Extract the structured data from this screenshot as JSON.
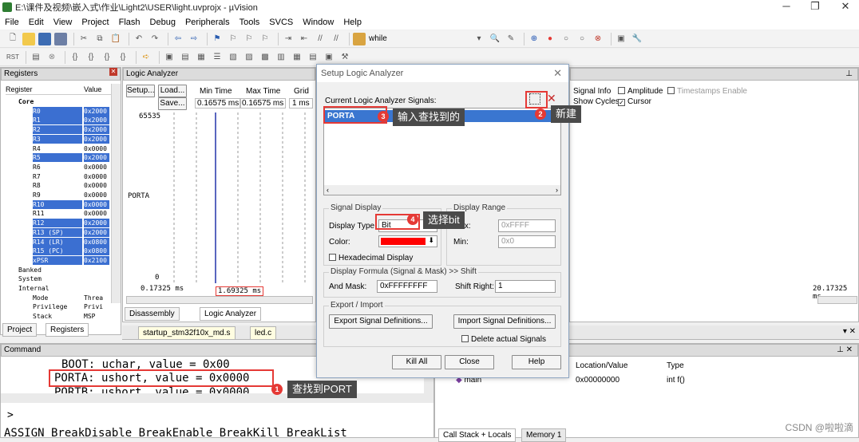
{
  "window": {
    "title": "E:\\课件及视频\\嵌入式\\作业\\Light2\\USER\\light.uvprojx - µVision",
    "minimize": "─",
    "maximize": "❐",
    "close": "✕"
  },
  "menu": [
    "File",
    "Edit",
    "View",
    "Project",
    "Flash",
    "Debug",
    "Peripherals",
    "Tools",
    "SVCS",
    "Window",
    "Help"
  ],
  "toolbar": {
    "search_text": "while"
  },
  "registers": {
    "title": "Registers",
    "col_register": "Register",
    "col_value": "Value",
    "rows": [
      {
        "name": "Core",
        "value": "",
        "sel": false
      },
      {
        "name": "R0",
        "value": "0x2000",
        "sel": true
      },
      {
        "name": "R1",
        "value": "0x2000",
        "sel": true
      },
      {
        "name": "R2",
        "value": "0x2000",
        "sel": true
      },
      {
        "name": "R3",
        "value": "0x2000",
        "sel": true
      },
      {
        "name": "R4",
        "value": "0x0000",
        "sel": false
      },
      {
        "name": "R5",
        "value": "0x2000",
        "sel": true
      },
      {
        "name": "R6",
        "value": "0x0000",
        "sel": false
      },
      {
        "name": "R7",
        "value": "0x0000",
        "sel": false
      },
      {
        "name": "R8",
        "value": "0x0000",
        "sel": false
      },
      {
        "name": "R9",
        "value": "0x0000",
        "sel": false
      },
      {
        "name": "R10",
        "value": "0x0000",
        "sel": true
      },
      {
        "name": "R11",
        "value": "0x0000",
        "sel": false
      },
      {
        "name": "R12",
        "value": "0x2000",
        "sel": true
      },
      {
        "name": "R13 (SP)",
        "value": "0x2000",
        "sel": true
      },
      {
        "name": "R14 (LR)",
        "value": "0x0800",
        "sel": true
      },
      {
        "name": "R15 (PC)",
        "value": "0x0800",
        "sel": true
      },
      {
        "name": "xPSR",
        "value": "0x2100",
        "sel": true
      },
      {
        "name": "Banked",
        "value": "",
        "sel": false
      },
      {
        "name": "System",
        "value": "",
        "sel": false
      },
      {
        "name": "Internal",
        "value": "",
        "sel": false
      },
      {
        "name": "Mode",
        "value": "Threa",
        "sel": false
      },
      {
        "name": "Privilege",
        "value": "Privi",
        "sel": false
      },
      {
        "name": "Stack",
        "value": "MSP",
        "sel": false
      }
    ],
    "tab_project": "Project",
    "tab_registers": "Registers"
  },
  "logic": {
    "title": "Logic Analyzer",
    "setup": "Setup...",
    "load": "Load...",
    "save": "Save...",
    "min_time_label": "Min Time",
    "min_time": "0.16575 ms",
    "max_time_label": "Max Time",
    "max_time": "0.16575 ms",
    "grid_label": "Grid",
    "grid": "1 ms",
    "y_top": "65535",
    "y_bottom": "0",
    "signal": "PORTA",
    "t_left": "0.17325 ms",
    "t_cursor": "1.69325 ms",
    "t_right": "20.17325 ms",
    "tab_disassembly": "Disassembly",
    "tab_logic": "Logic Analyzer",
    "signal_info": "Signal Info",
    "amplitude": "Amplitude",
    "timestamps": "Timestamps Enable",
    "show_cycles": "Show Cycles",
    "cursor": "Cursor"
  },
  "files": {
    "tab1": "startup_stm32f10x_md.s",
    "tab2": "led.c"
  },
  "dialog": {
    "title": "Setup Logic Analyzer",
    "signals_label": "Current Logic Analyzer Signals:",
    "signal_item": "PORTA",
    "signal_display": "Signal Display",
    "display_type_label": "Display Type:",
    "display_type": "Bit",
    "color_label": "Color:",
    "hex_label": "Hexadecimal Display",
    "display_range": "Display Range",
    "max_label": "Max:",
    "max": "0xFFFF",
    "min_label": "Min:",
    "min": "0x0",
    "formula": "Display Formula (Signal & Mask) >> Shift",
    "and_mask_label": "And Mask:",
    "and_mask": "0xFFFFFFFF",
    "shift_label": "Shift Right:",
    "shift": "1",
    "export_import": "Export / Import",
    "export_btn": "Export Signal Definitions...",
    "import_btn": "Import Signal Definitions...",
    "delete_label": "Delete actual Signals",
    "kill_all": "Kill All",
    "close": "Close",
    "help": "Help",
    "color_value": "#ff0000"
  },
  "command": {
    "title": "Command",
    "line1": "BOOT:  uchar, value = 0x00",
    "line2": "PORTA: ushort, value = 0x0000",
    "line3": "PORTB: ushort, value = 0x0000",
    "prompt": ">",
    "hints": "ASSIGN BreakDisable BreakEnable BreakKill BreakList"
  },
  "callstack": {
    "col_location": "Location/Value",
    "col_type": "Type",
    "row_name": "main",
    "row_loc": "0x00000000",
    "row_type": "int f()",
    "tab1": "Call Stack + Locals",
    "tab2": "Memory 1"
  },
  "annotations": {
    "a1_num": "1",
    "a1": "查找到PORT",
    "a2_num": "2",
    "a2": "新建",
    "a3_num": "3",
    "a3": "输入查找到的",
    "a4_num": "4",
    "a4": "选择bit"
  },
  "watermark": "CSDN @啦啦滴"
}
